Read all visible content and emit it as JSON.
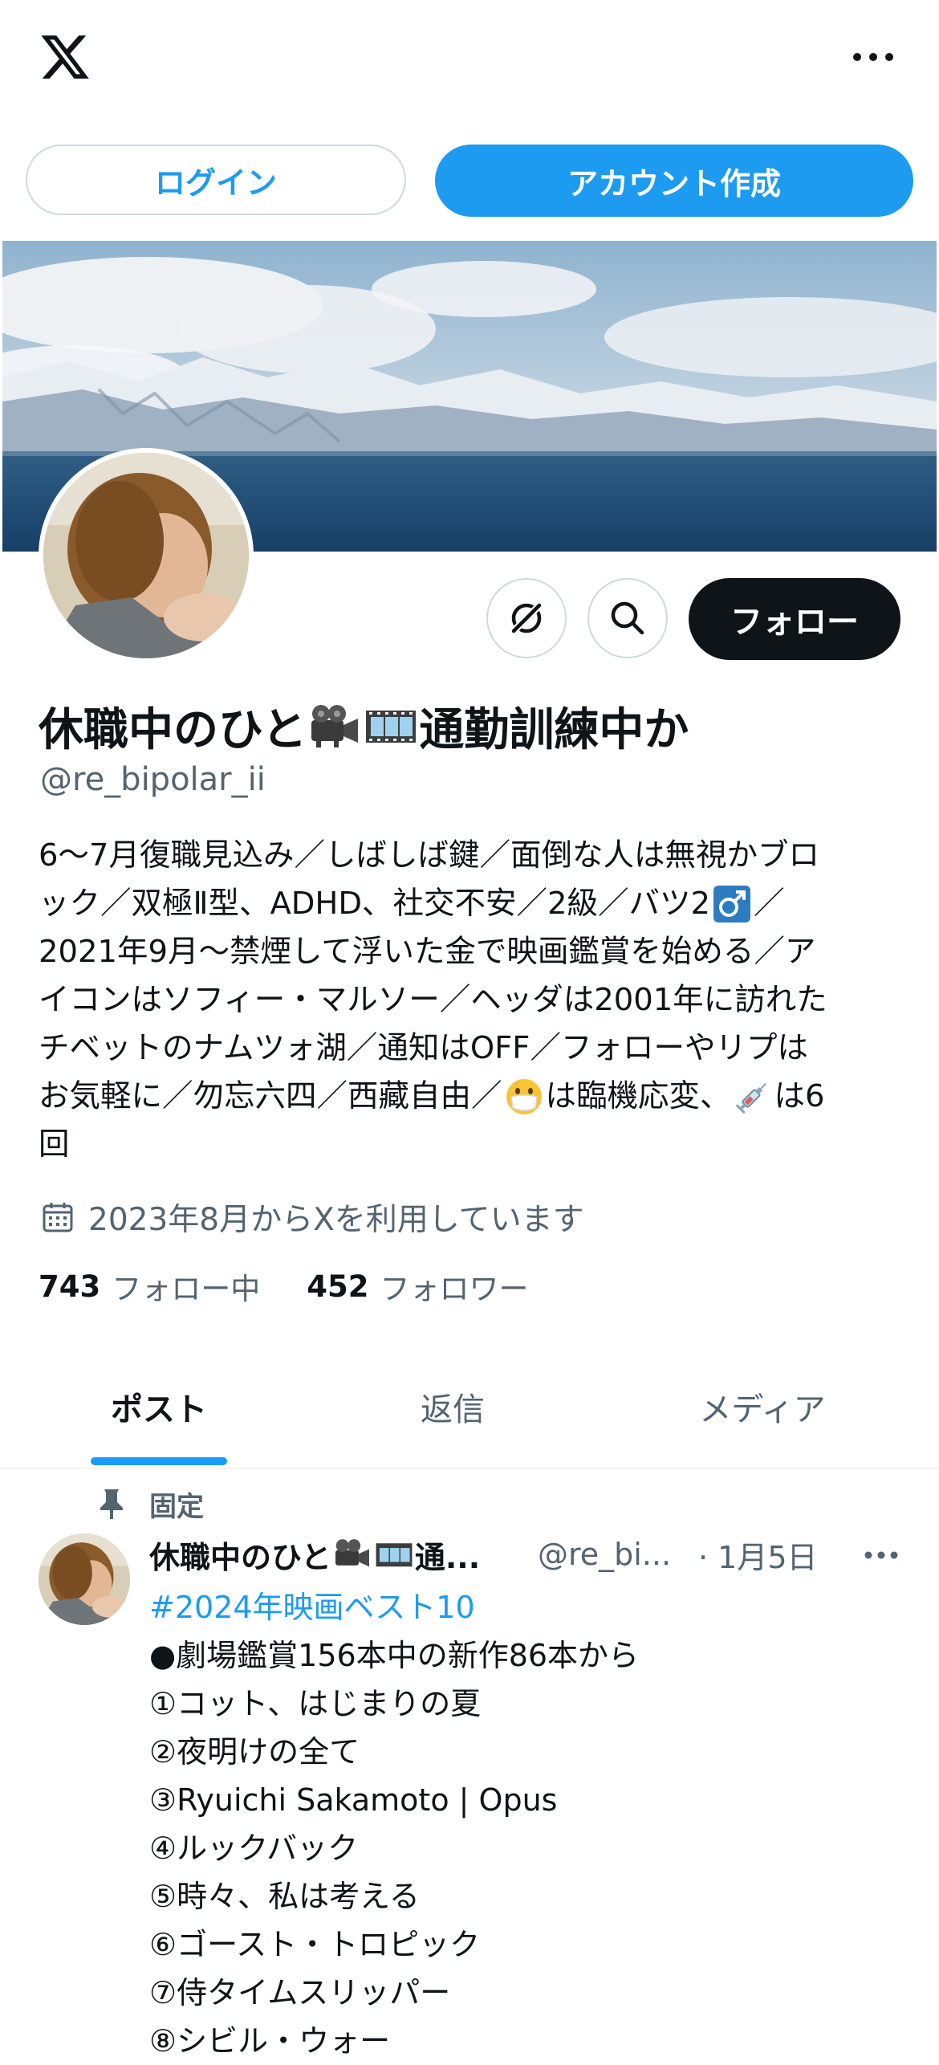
{
  "header": {
    "logo_icon": "x-logo-icon",
    "more_icon": "more-options-icon",
    "login_label": "ログイン",
    "signup_label": "アカウント作成"
  },
  "profile": {
    "display_name_start": "休職中のひと",
    "display_name_end": "通勤訓練中か",
    "name_emojis": [
      "film-projector-icon",
      "film-frames-icon"
    ],
    "handle": "@re_bipolar_ii",
    "follow_label": "フォロー",
    "bio_lines": [
      "6〜7月復職見込み／しばしば鍵／面倒な人は無視かブロ",
      "ック／双極Ⅱ型、ADHD、社交不安／2級／バツ2",
      "2021年9月〜禁煙して浮いた金で映画鑑賞を始める／ア",
      "イコンはソフィー・マルソー／ヘッダは2001年に訪れた",
      "チベットのナムツォ湖／通知はOFF／フォローやリプは",
      "お気軽に／勿忘六四／西藏自由／",
      "回"
    ],
    "bio_line2_tail": "／",
    "bio_line6_mid": "は臨機応変、",
    "bio_line6_tail": "は6",
    "joined": "2023年8月からXを利用しています",
    "following_count": "743",
    "following_label": "フォロー中",
    "followers_count": "452",
    "followers_label": "フォロワー"
  },
  "tabs": [
    {
      "label": "ポスト",
      "active": true
    },
    {
      "label": "返信",
      "active": false
    },
    {
      "label": "メディア",
      "active": false
    }
  ],
  "pinned_post": {
    "pinned_label": "固定",
    "author_name": "休職中のひと",
    "author_name_tail": "通...",
    "author_handle": "@re_bi...",
    "date": "· 1月5日",
    "hashtag": "#2024年映画ベスト10",
    "lines": [
      "●劇場鑑賞156本中の新作86本から",
      "①コット、はじまりの夏",
      "②夜明けの全て",
      "③Ryuichi Sakamoto | Opus",
      "④ルックバック",
      "⑤時々、私は考える",
      "⑥ゴースト・トロピック",
      "⑦侍タイムスリッパー",
      "⑧シビル・ウォー"
    ]
  },
  "colors": {
    "accent": "#1d9bf0",
    "text": "#0f1419",
    "secondary": "#536471",
    "border": "#cfd9de"
  }
}
